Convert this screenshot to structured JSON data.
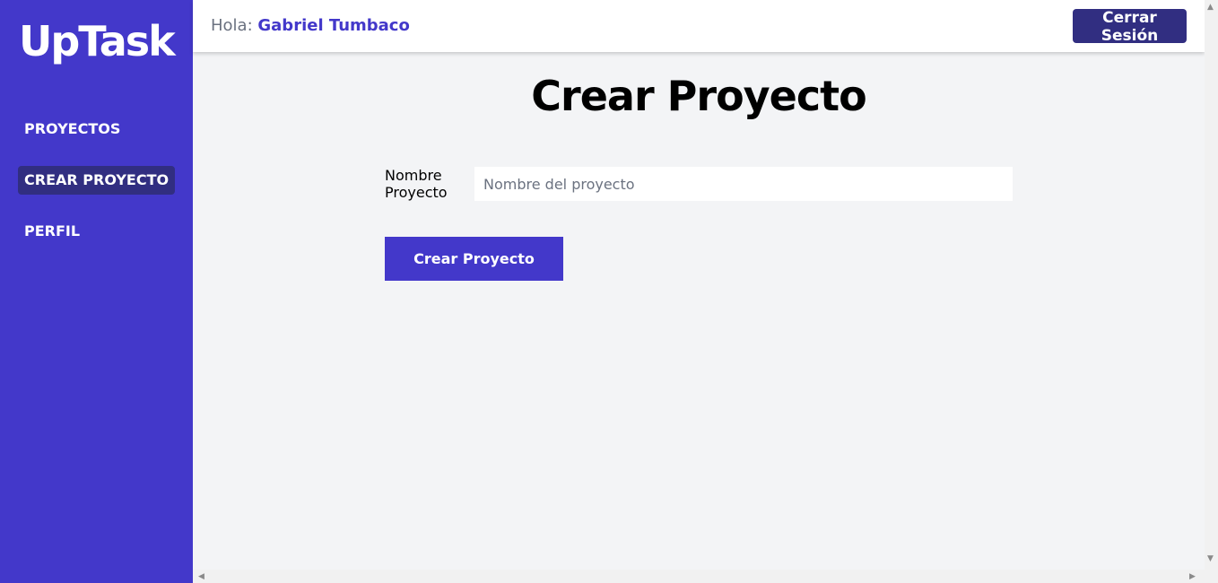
{
  "sidebar": {
    "logo": "UpTask",
    "items": [
      {
        "label": "PROYECTOS",
        "active": false
      },
      {
        "label": "CREAR PROYECTO",
        "active": true
      },
      {
        "label": "PERFIL",
        "active": false
      }
    ]
  },
  "header": {
    "greeting_prefix": "Hola:",
    "user_name": "Gabriel Tumbaco",
    "logout_label": "Cerrar Sesión"
  },
  "main": {
    "title": "Crear Proyecto",
    "field_label": "Nombre Proyecto",
    "field_placeholder": "Nombre del proyecto",
    "field_value": "",
    "submit_label": "Crear Proyecto"
  },
  "colors": {
    "sidebar_bg": "#4338ca",
    "active_item_bg": "#312e81",
    "accent": "#4338ca",
    "page_bg": "#f3f4f6"
  },
  "icons": {
    "scroll_up": "triangle-up",
    "scroll_down": "triangle-down",
    "scroll_left": "triangle-left",
    "scroll_right": "triangle-right"
  }
}
